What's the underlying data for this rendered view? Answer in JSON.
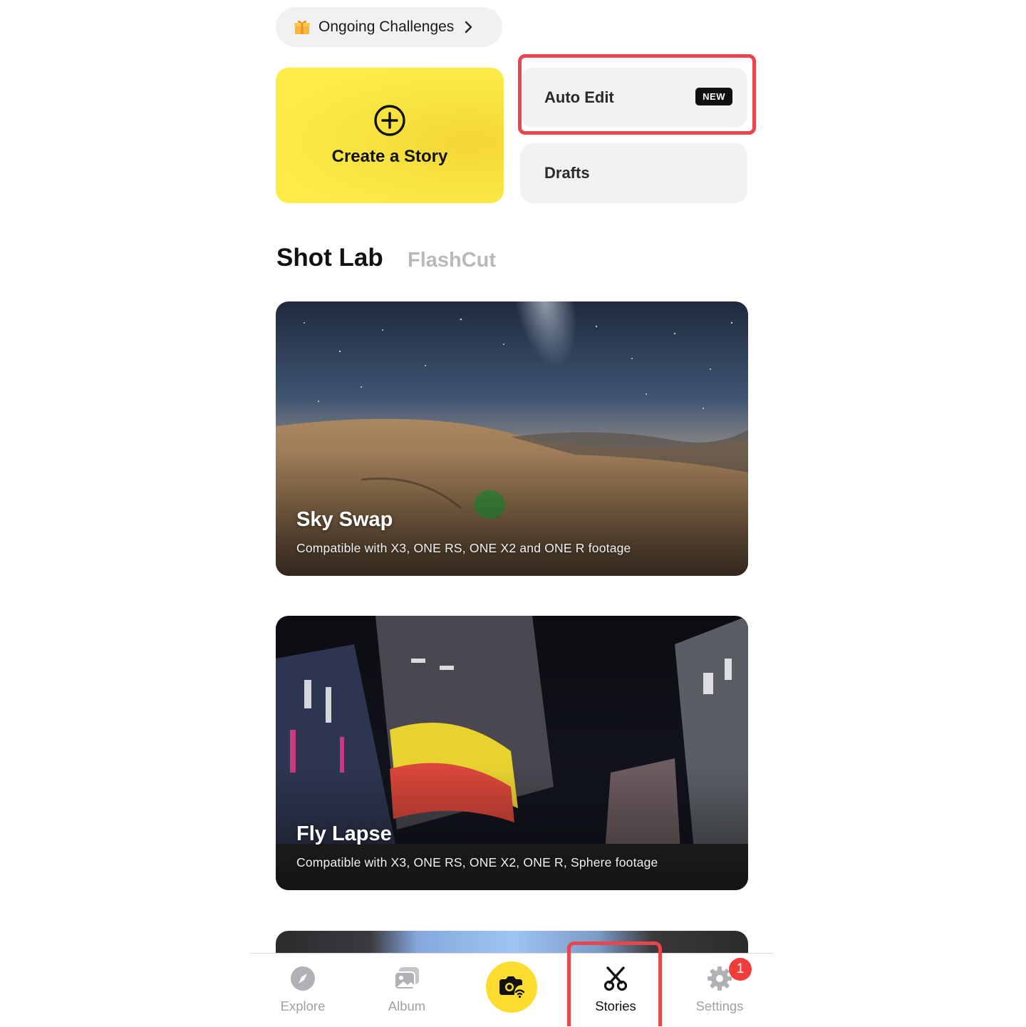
{
  "challenges": {
    "label": "Ongoing Challenges"
  },
  "create": {
    "label": "Create a Story"
  },
  "auto_edit": {
    "label": "Auto Edit",
    "badge": "NEW"
  },
  "drafts": {
    "label": "Drafts"
  },
  "tabs": [
    {
      "label": "Shot Lab",
      "active": true
    },
    {
      "label": "FlashCut",
      "active": false
    }
  ],
  "features": [
    {
      "title": "Sky Swap",
      "subtitle": "Compatible with X3, ONE RS, ONE X2 and ONE R footage"
    },
    {
      "title": "Fly Lapse",
      "subtitle": "Compatible with X3, ONE RS, ONE X2, ONE R, Sphere footage"
    }
  ],
  "nav": {
    "items": [
      {
        "label": "Explore",
        "icon": "compass-icon",
        "active": false
      },
      {
        "label": "Album",
        "icon": "album-icon",
        "active": false
      },
      {
        "label": "",
        "icon": "camera-wifi-icon",
        "active": false
      },
      {
        "label": "Stories",
        "icon": "scissors-icon",
        "active": true
      },
      {
        "label": "Settings",
        "icon": "gear-icon",
        "active": false,
        "badge": "1"
      }
    ]
  },
  "colors": {
    "accent_yellow": "#fcdd2f",
    "highlight_red": "#e8464c",
    "badge_red": "#ef3d3a"
  }
}
